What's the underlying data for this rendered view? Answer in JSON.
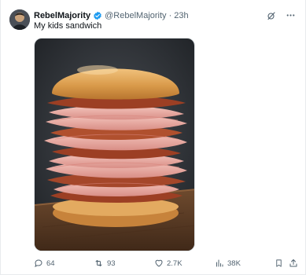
{
  "tweet": {
    "display_name": "RebelMajority",
    "handle": "@RebelMajority",
    "separator": "·",
    "time": "23h",
    "text": "My kids sandwich",
    "verified_color": "#1d9bf0"
  },
  "image": {
    "subject": "ham-and-bacon-stack-sandwich",
    "colors": {
      "bun": "#d99a4a",
      "ham": "#e8a8a0",
      "bacon": "#9c3f24",
      "board": "#5a3a24",
      "background": "#2e3136"
    }
  },
  "actions": {
    "reply_count": "64",
    "retweet_count": "93",
    "like_count": "2.7K",
    "views_count": "38K"
  }
}
